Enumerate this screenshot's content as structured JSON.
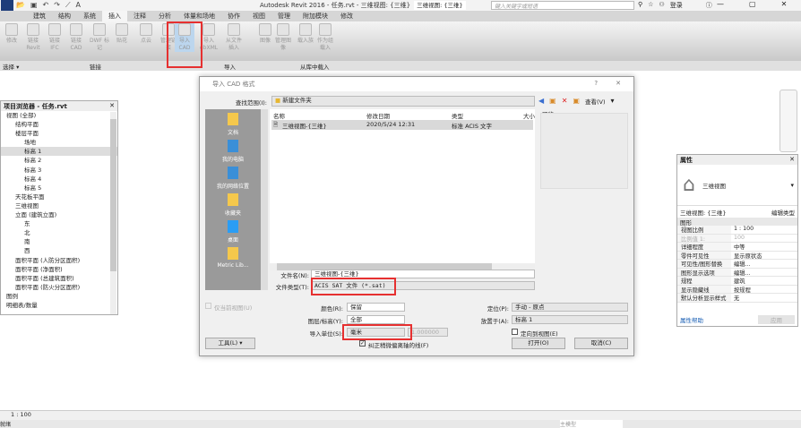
{
  "app": {
    "title": "Autodesk Revit 2016 -   任务.rvt - 三维视图: {三维}",
    "view_selector": "三维视图: {三维}",
    "search_placeholder": "键入关键字或短语",
    "login": "登录"
  },
  "tabs": [
    "建筑",
    "结构",
    "系统",
    "插入",
    "注释",
    "分析",
    "体量和场地",
    "协作",
    "视图",
    "管理",
    "附加模块",
    "修改"
  ],
  "active_tab": "插入",
  "ribbon": {
    "buttons": [
      "修改",
      "链接 Revit",
      "链接 IFC",
      "链接 CAD",
      "DWF 标记",
      "贴花",
      "点云",
      "管理链接",
      "导入 CAD",
      "导入 gbXML",
      "从文件插入",
      "图像",
      "管理图像",
      "载入族",
      "作为组载入"
    ],
    "panels": [
      "选择 ▾",
      "链接",
      "导入",
      "从库中载入"
    ]
  },
  "browser": {
    "title": "项目浏览器 - 任务.rvt",
    "items": [
      "视图 (全部)",
      "结构平面",
      "楼层平面",
      "场地",
      "标高 1",
      "标高 2",
      "标高 3",
      "标高 4",
      "标高 5",
      "天花板平面",
      "三维视图",
      "立面 (建筑立面)",
      "东",
      "北",
      "南",
      "西",
      "面积平面 (人防分区面积)",
      "面积平面 (净面积)",
      "面积平面 (总建筑面积)",
      "面积平面 (防火分区面积)",
      "图例",
      "明细表/数量"
    ]
  },
  "dialog": {
    "title": "导入 CAD 格式",
    "help": "?",
    "close": "✕",
    "lookin_label": "查找范围(I):",
    "lookin_value": "新建文件夹",
    "view_menu": "查看(V)",
    "preview_label": "预览",
    "places": [
      "文档",
      "我的电脑",
      "我的网络位置",
      "收藏夹",
      "桌面",
      "Metric Lib..."
    ],
    "columns": [
      "名称",
      "修改日期",
      "类型",
      "大小"
    ],
    "files": [
      {
        "name": "三维视图-{三维}",
        "date": "2020/5/24 12:31",
        "type": "标准 ACIS 文字"
      }
    ],
    "filename_label": "文件名(N):",
    "filename_value": "三维视图-{三维}",
    "filetype_label": "文件类型(T):",
    "filetype_value": "ACIS SAT 文件 (*.sat)",
    "current_view_only": "仅当前视图(U)",
    "color_label": "颜色(R):",
    "color_value": "保留",
    "layers_label": "图层/标高(Y):",
    "layers_value": "全部",
    "units_label": "导入单位(S):",
    "units_value": "毫米",
    "scale_value": "1.000000",
    "correct_lines": "纠正稍微偏离轴的线(F)",
    "position_label": "定位(P):",
    "position_value": "手动 - 原点",
    "place_at_label": "放置于(A):",
    "place_at_value": "标高 1",
    "orient_label": "定向到视图(E)",
    "tools": "工具(L)",
    "open": "打开(O)",
    "cancel": "取消(C)"
  },
  "properties": {
    "title": "属性",
    "type_name": "三维视图",
    "instance": "三维视图: {三维}",
    "edit_type": "编辑类型",
    "group": "图形",
    "rows": [
      [
        "视图比例",
        "1 : 100"
      ],
      [
        "比例值 1:",
        "100"
      ],
      [
        "详细程度",
        "中等"
      ],
      [
        "零件可见性",
        "显示原状态"
      ],
      [
        "可见性/图形替换",
        "编辑..."
      ],
      [
        "图形显示选项",
        "编辑..."
      ],
      [
        "规程",
        "建筑"
      ],
      [
        "显示隐藏线",
        "按规程"
      ],
      [
        "默认分析显示样式",
        "无"
      ]
    ],
    "help": "属性帮助",
    "apply": "应用"
  },
  "viewbar": {
    "scale": "1 : 100"
  },
  "statusbar": {
    "ready": "就绪",
    "model": "主模型"
  }
}
